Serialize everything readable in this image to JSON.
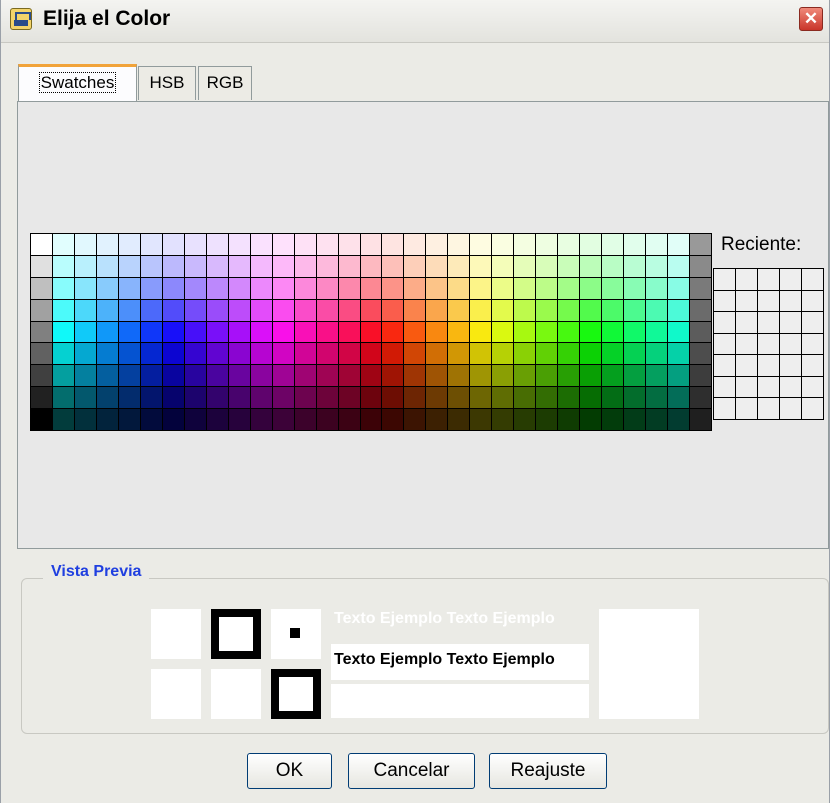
{
  "window": {
    "title": "Elija el Color"
  },
  "tabs": [
    {
      "label": "Swatches",
      "mnemonic": "S",
      "active": true
    },
    {
      "label": "HSB",
      "mnemonic": "H",
      "active": false
    },
    {
      "label": "RGB",
      "mnemonic": "G",
      "active": false
    }
  ],
  "swatches": {
    "columns": 31,
    "rows": 9
  },
  "recent": {
    "label": "Reciente:",
    "columns": 5,
    "rows": 7,
    "empty_color": "#eeeeee"
  },
  "preview": {
    "title": "Vista Previa",
    "sample_text_1": "Texto Ejemplo Texto Ejemplo",
    "sample_text_2": "Texto Ejemplo Texto Ejemplo",
    "color": "#ffffff"
  },
  "buttons": {
    "ok": "OK",
    "cancel": "Cancelar",
    "reset": "Reajuste"
  },
  "colors": {
    "tab_accent": "#f1a33a",
    "preview_title": "#1f3fe0",
    "window_bg": "#ebebe6"
  }
}
